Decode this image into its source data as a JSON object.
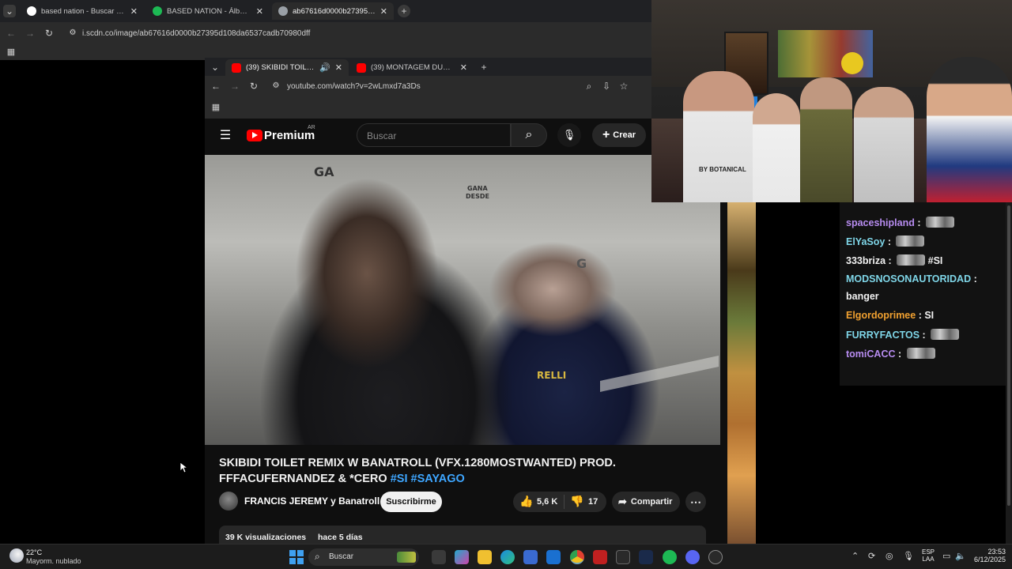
{
  "outer_browser": {
    "tabs": [
      {
        "title": "based nation - Buscar con Goog",
        "favicon_color": "#ffffff"
      },
      {
        "title": "BASED NATION - Álbum de roc",
        "favicon_color": "#1db954"
      },
      {
        "title": "ab67616d0000b27395d108da6",
        "favicon_color": "#9aa0a6"
      }
    ],
    "new_tab": "+",
    "url": "i.scdn.co/image/ab67616d0000b27395d108da6537cadb70980dff"
  },
  "inner_browser": {
    "tabs": [
      {
        "title": "(39) SKIBIDI TOILET REMIX",
        "favicon_color": "#ff0000"
      },
      {
        "title": "(39) MONTAGEM DUBAI - YouT",
        "favicon_color": "#ff0000"
      }
    ],
    "url": "youtube.com/watch?v=2wLmxd7a3Ds"
  },
  "youtube": {
    "logo_text": "Premium",
    "region": "AR",
    "search_placeholder": "Buscar",
    "create_label": "Crear",
    "video_sign_text": [
      "GA",
      "GANA",
      "DESDE",
      "G",
      "RELLI"
    ],
    "title_main": "SKIBIDI TOILET REMIX W BANATROLL (VFX.1280MOSTWANTED) PROD. FFFACUFERNANDEZ & *CERO",
    "title_tags": [
      "#SI",
      "#SAYAGO"
    ],
    "channel": "FRANCIS JEREMY y Banatroll",
    "subscribe_label": "Suscribirme",
    "likes": "5,6 K",
    "dislikes": "17",
    "share_label": "Compartir",
    "views": "39 K visualizaciones",
    "age": "hace 5 días"
  },
  "chat": [
    {
      "user": "spaceshipland",
      "color": "#b78cf0",
      "text": ""
    },
    {
      "user": "ElYaSoy",
      "color": "#7fd6e8",
      "text": ""
    },
    {
      "user": "333briza",
      "color": "#f2f2f2",
      "text": "#SI"
    },
    {
      "user": "MODSNOSONAUTORIDAD",
      "color": "#7fd6e8",
      "text": "banger"
    },
    {
      "user": "Elgordoprimee",
      "color": "#f0a030",
      "text": "SI"
    },
    {
      "user": "FURRYFACTOS",
      "color": "#7fd6e8",
      "text": ""
    },
    {
      "user": "tomiCACC",
      "color": "#b78cf0",
      "text": ""
    }
  ],
  "cam_sign": "BY BOTANICAL",
  "taskbar": {
    "weather_temp": "22°C",
    "weather_desc": "Mayorm. nublado",
    "search_label": "Buscar",
    "lang": "ESP",
    "lang2": "LAA",
    "time": "23:53",
    "date": "6/12/2025"
  }
}
